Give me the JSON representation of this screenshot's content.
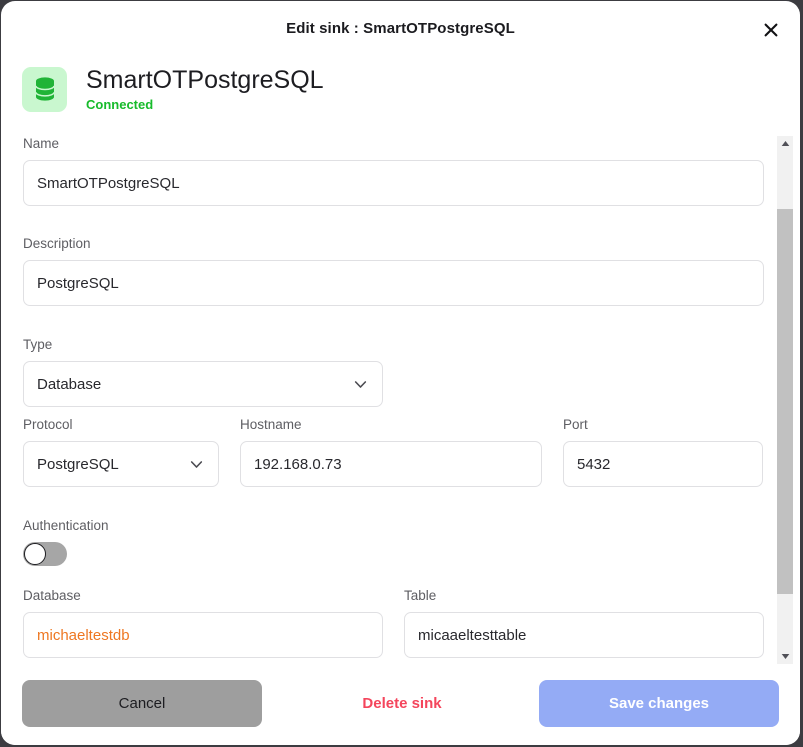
{
  "window": {
    "title": "Edit sink : SmartOTPostgreSQL",
    "close_label": "✕"
  },
  "header": {
    "icon": "database-icon",
    "name": "SmartOTPostgreSQL",
    "status": "Connected",
    "status_color": "#17bb2b",
    "icon_bg": "#c9f7cf",
    "icon_color": "#20b437"
  },
  "form": {
    "name": {
      "label": "Name",
      "value": "SmartOTPostgreSQL",
      "placeholder": "Name"
    },
    "description": {
      "label": "Description",
      "value": "PostgreSQL",
      "placeholder": "Description"
    },
    "type": {
      "label": "Type",
      "value": "Database",
      "options": [
        "Database"
      ]
    },
    "protocol": {
      "label": "Protocol",
      "value": "PostgreSQL",
      "options": [
        "PostgreSQL"
      ]
    },
    "hostname": {
      "label": "Hostname",
      "value": "192.168.0.73",
      "placeholder": "Hostname"
    },
    "port": {
      "label": "Port",
      "value": "5432",
      "placeholder": "Port"
    },
    "authentication": {
      "label": "Authentication",
      "enabled": false
    },
    "database": {
      "label": "Database",
      "value": "michaeltestdb",
      "placeholder": "Database",
      "value_color": "#ee7722"
    },
    "table": {
      "label": "Table",
      "value": "micaaeltesttable",
      "placeholder": "Table"
    }
  },
  "footer": {
    "cancel_label": "Cancel",
    "delete_label": "Delete sink",
    "save_label": "Save changes",
    "cancel_color": "#9e9e9e",
    "delete_color": "#f4455c",
    "save_color": "#94abf5"
  }
}
